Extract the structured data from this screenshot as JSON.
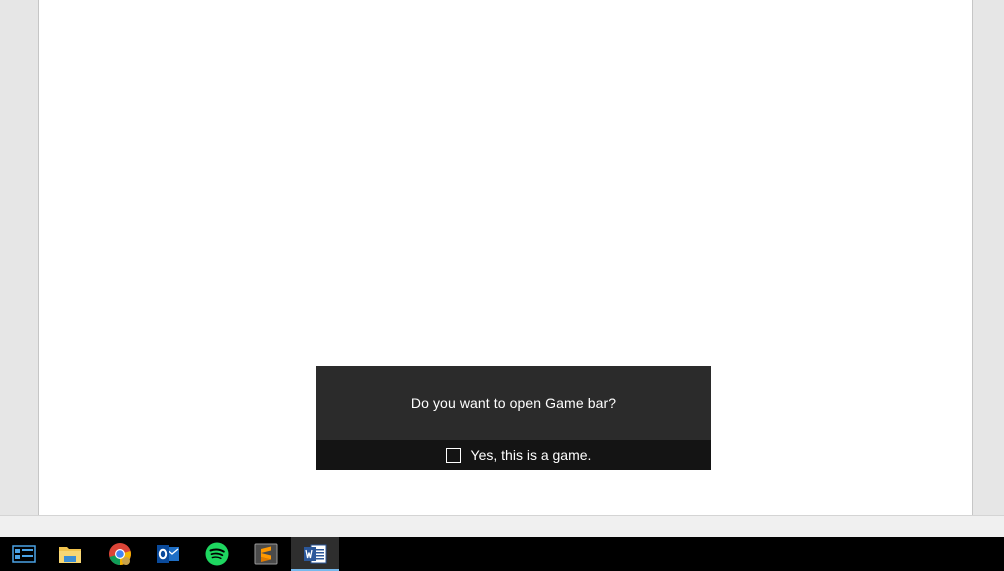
{
  "game_bar_prompt": {
    "question": "Do you want to open Game bar?",
    "checkbox_label": "Yes, this is a game.",
    "checkbox_checked": false
  },
  "taskbar": {
    "apps": [
      {
        "name": "task-view",
        "icon": "task-view-icon"
      },
      {
        "name": "file-explorer",
        "icon": "folder-icon"
      },
      {
        "name": "chrome",
        "icon": "chrome-icon"
      },
      {
        "name": "outlook",
        "icon": "outlook-icon"
      },
      {
        "name": "spotify",
        "icon": "spotify-icon"
      },
      {
        "name": "sublime-text",
        "icon": "sublime-text-icon"
      },
      {
        "name": "word",
        "icon": "word-icon",
        "active": true
      }
    ]
  },
  "colors": {
    "prompt_bg": "#2b2b2b",
    "prompt_footer_bg": "#141414",
    "taskbar_bg": "#000000",
    "active_indicator": "#76b9ed"
  }
}
